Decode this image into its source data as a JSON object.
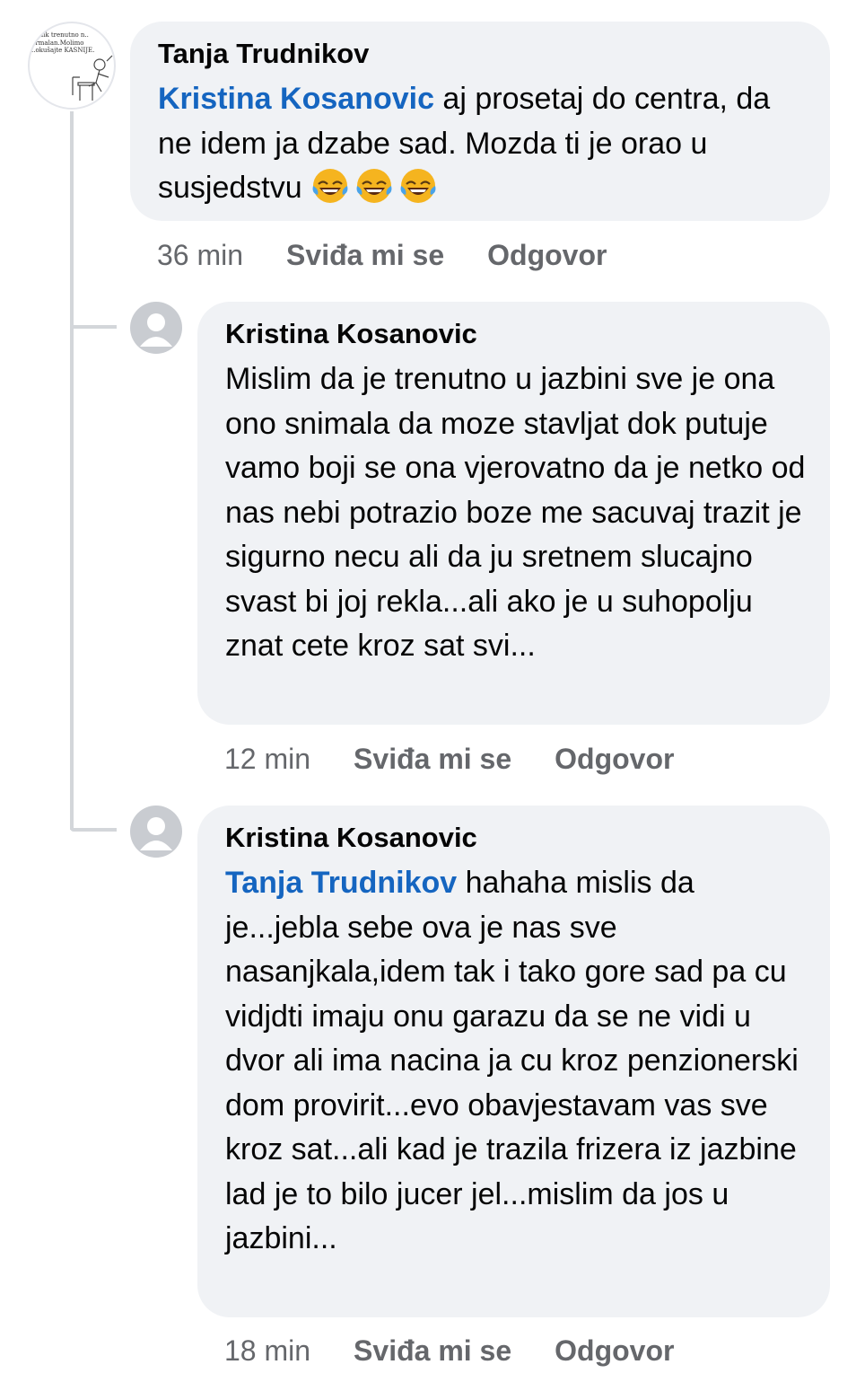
{
  "comments": [
    {
      "author": "Tanja Trudnikov",
      "mention": "Kristina Kosanovic",
      "text": " aj prosetaj do centra, da ne idem ja dzabe sad. Mozda ti je orao u susjedstvu ",
      "emojis": [
        "face-with-tears-of-joy-emoji",
        "face-with-tears-of-joy-emoji",
        "face-with-tears-of-joy-emoji"
      ],
      "time": "36 min",
      "like_label": "Sviđa mi se",
      "reply_label": "Odgovor",
      "avatar_text": "..anik trenutno n.. ..rmalan.Molimo ..okušajte KASNIJE."
    },
    {
      "author": "Kristina Kosanovic",
      "text": "Mislim da je trenutno u jazbini sve je ona ono snimala da moze stavljat dok putuje vamo boji se ona vjerovatno da je netko od nas nebi potrazio boze me sacuvaj trazit je sigurno necu ali da ju sretnem slucajno svast bi joj rekla...ali ako je u suhopolju znat cete kroz sat svi...",
      "time": "12 min",
      "like_label": "Sviđa mi se",
      "reply_label": "Odgovor"
    },
    {
      "author": "Kristina Kosanovic",
      "mention": "Tanja Trudnikov",
      "text": " hahaha mislis da je...jebla sebe ova je nas sve nasanjkala,idem tak i tako gore sad pa cu vidjdti imaju onu garazu da se ne vidi u dvor ali ima nacina ja cu kroz penzionerski dom provirit...evo obavjestavam vas sve kroz sat...ali kad je trazila frizera iz jazbine lad je to bilo jucer jel...mislim da jos u jazbini...",
      "time": "18 min",
      "like_label": "Sviđa mi se",
      "reply_label": "Odgovor"
    }
  ],
  "colors": {
    "bubble": "#f0f2f5",
    "mention": "#1565c0",
    "meta": "#65676b",
    "thread_line": "#d3d6da"
  }
}
